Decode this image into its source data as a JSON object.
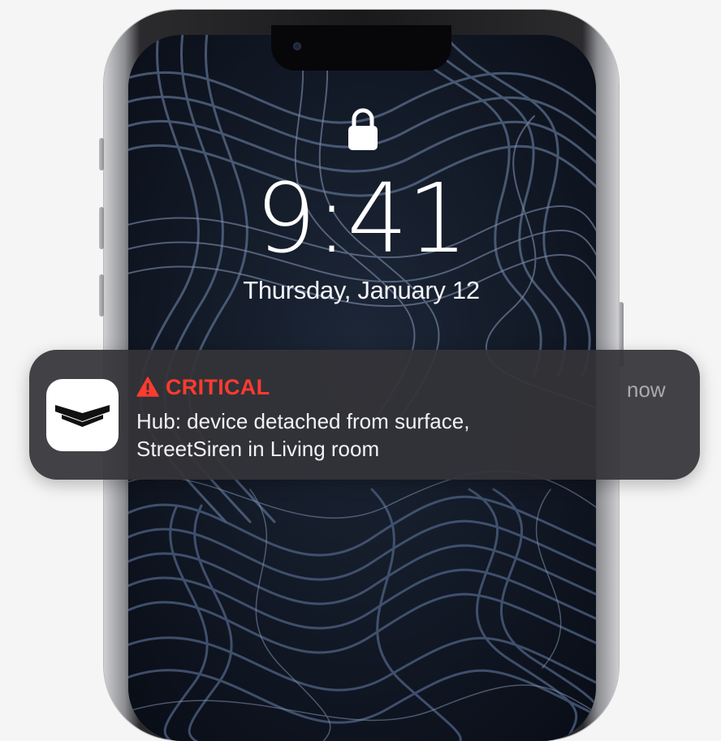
{
  "lockscreen": {
    "time": "9:41",
    "date": "Thursday, January 12",
    "lock_icon": "lock-icon"
  },
  "notification": {
    "app_icon": "hexagon-logo-icon",
    "level_icon": "warning-triangle-icon",
    "level": "CRITICAL",
    "timestamp": "now",
    "line1": "Hub: device detached from surface,",
    "line2": "StreetSiren in Living room",
    "accent_color": "#ff3b30"
  }
}
